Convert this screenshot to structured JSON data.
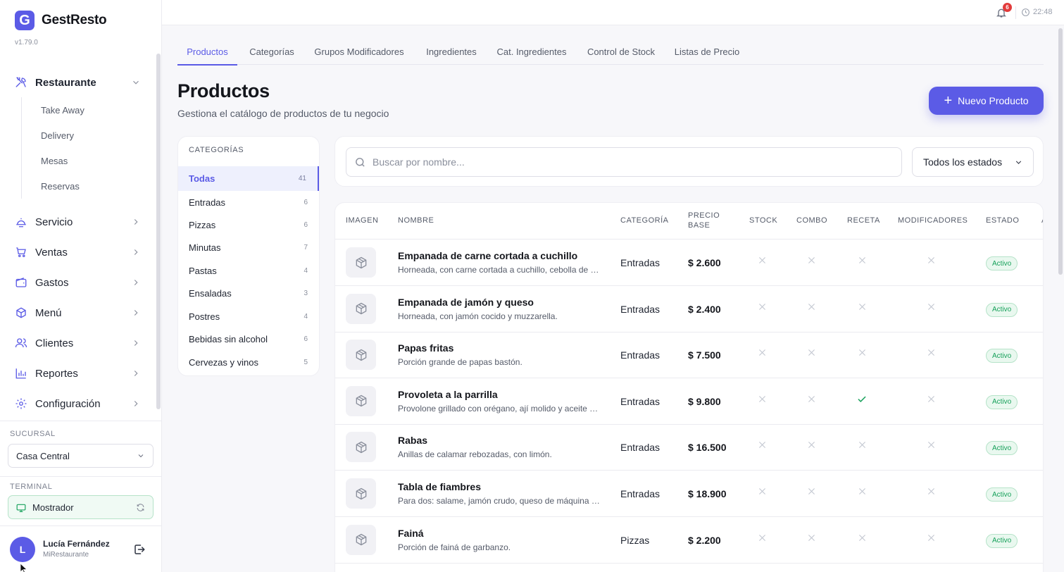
{
  "brand": {
    "logo_letter": "G",
    "name": "GestResto",
    "version": "v1.79.0"
  },
  "sidebar": {
    "items": [
      {
        "label": "Restaurante",
        "icon": "utensils-icon",
        "open": true
      },
      {
        "label": "Servicio",
        "icon": "service-bell-icon"
      },
      {
        "label": "Ventas",
        "icon": "cart-icon"
      },
      {
        "label": "Gastos",
        "icon": "wallet-icon"
      },
      {
        "label": "Menú",
        "icon": "box-icon"
      },
      {
        "label": "Clientes",
        "icon": "users-icon"
      },
      {
        "label": "Reportes",
        "icon": "bar-chart-icon"
      },
      {
        "label": "Configuración",
        "icon": "gear-icon"
      }
    ],
    "subitems": [
      "Take Away",
      "Delivery",
      "Mesas",
      "Reservas"
    ],
    "branch_label": "SUCURSAL",
    "branch_value": "Casa Central",
    "terminal_label": "TERMINAL",
    "terminal_value": "Mostrador",
    "user": {
      "initial": "L",
      "name": "Lucía Fernández",
      "org": "MiRestaurante"
    }
  },
  "topbar": {
    "notifications": "6",
    "time": "22:48"
  },
  "tabs": [
    "Productos",
    "Categorías",
    "Grupos Modificadores",
    "Ingredientes",
    "Cat. Ingredientes",
    "Control de Stock",
    "Listas de Precio"
  ],
  "page": {
    "title": "Productos",
    "subtitle": "Gestiona el catálogo de productos de tu negocio",
    "new_button": "Nuevo Producto"
  },
  "categories": {
    "heading": "CATEGORÍAS",
    "items": [
      {
        "name": "Todas",
        "count": "41"
      },
      {
        "name": "Entradas",
        "count": "6"
      },
      {
        "name": "Pizzas",
        "count": "6"
      },
      {
        "name": "Minutas",
        "count": "7"
      },
      {
        "name": "Pastas",
        "count": "4"
      },
      {
        "name": "Ensaladas",
        "count": "3"
      },
      {
        "name": "Postres",
        "count": "4"
      },
      {
        "name": "Bebidas sin alcohol",
        "count": "6"
      },
      {
        "name": "Cervezas y vinos",
        "count": "5"
      }
    ]
  },
  "search": {
    "placeholder": "Buscar por nombre...",
    "status_value": "Todos los estados"
  },
  "table": {
    "headers": {
      "imagen": "IMAGEN",
      "nombre": "NOMBRE",
      "categoria": "CATEGORÍA",
      "precio_1": "PRECIO",
      "precio_2": "BASE",
      "stock": "STOCK",
      "combo": "COMBO",
      "receta": "RECETA",
      "modificadores": "MODIFICADORES",
      "estado": "ESTADO",
      "extra": "A"
    },
    "rows": [
      {
        "name": "Empanada de carne cortada a cuchillo",
        "desc": "Horneada, con carne cortada a cuchillo, cebolla de verdeo y huevo.",
        "category": "Entradas",
        "price": "$ 2.600",
        "stock": false,
        "combo": false,
        "recipe": false,
        "modifiers": false,
        "status": "Activo"
      },
      {
        "name": "Empanada de jamón y queso",
        "desc": "Horneada, con jamón cocido y muzzarella.",
        "category": "Entradas",
        "price": "$ 2.400",
        "stock": false,
        "combo": false,
        "recipe": false,
        "modifiers": false,
        "status": "Activo"
      },
      {
        "name": "Papas fritas",
        "desc": "Porción grande de papas bastón.",
        "category": "Entradas",
        "price": "$ 7.500",
        "stock": false,
        "combo": false,
        "recipe": false,
        "modifiers": false,
        "status": "Activo"
      },
      {
        "name": "Provoleta a la parrilla",
        "desc": "Provolone grillado con orégano, ají molido y aceite de oliva.",
        "category": "Entradas",
        "price": "$ 9.800",
        "stock": false,
        "combo": false,
        "recipe": true,
        "modifiers": false,
        "status": "Activo"
      },
      {
        "name": "Rabas",
        "desc": "Anillas de calamar rebozadas, con limón.",
        "category": "Entradas",
        "price": "$ 16.500",
        "stock": false,
        "combo": false,
        "recipe": false,
        "modifiers": false,
        "status": "Activo"
      },
      {
        "name": "Tabla de fiambres",
        "desc": "Para dos: salame, jamón crudo, queso de máquina y aceitunas.",
        "category": "Entradas",
        "price": "$ 18.900",
        "stock": false,
        "combo": false,
        "recipe": false,
        "modifiers": false,
        "status": "Activo"
      },
      {
        "name": "Fainá",
        "desc": "Porción de fainá de garbanzo.",
        "category": "Pizzas",
        "price": "$ 2.200",
        "stock": false,
        "combo": false,
        "recipe": false,
        "modifiers": false,
        "status": "Activo"
      }
    ]
  },
  "colors": {
    "accent": "#5b5be6",
    "success": "#16a05a",
    "danger": "#e23b3b"
  }
}
